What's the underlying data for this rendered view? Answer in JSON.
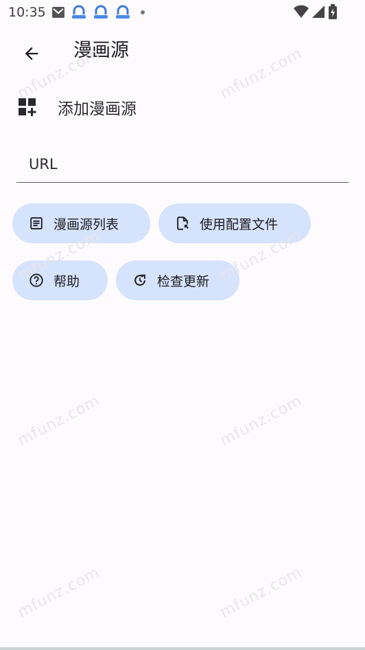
{
  "status_bar": {
    "time": "10:35"
  },
  "app_bar": {
    "title": "漫画源"
  },
  "section": {
    "title": "添加漫画源"
  },
  "url_input": {
    "placeholder": "URL",
    "value": ""
  },
  "chips": {
    "source_list": "漫画源列表",
    "use_config": "使用配置文件",
    "help": "帮助",
    "check_update": "检查更新"
  },
  "watermark": "mfunz.com",
  "colors": {
    "chip_bg": "#d6e3fd",
    "background": "#fefbff"
  }
}
